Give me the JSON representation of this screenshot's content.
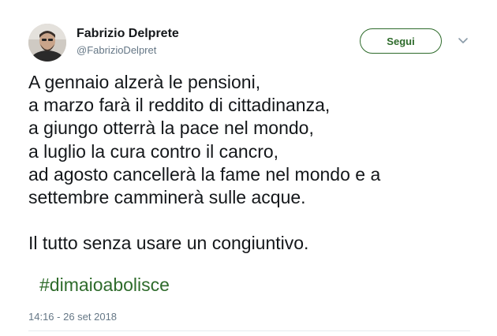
{
  "tweet": {
    "author": {
      "name": "Fabrizio Delprete",
      "handle": "@FabrizioDelpret",
      "avatar_icon": "user-avatar"
    },
    "follow_button_label": "Segui",
    "menu_icon": "chevron-down-icon",
    "text_lines": [
      "A gennaio alzerà le pensioni,",
      "a marzo farà il reddito di cittadinanza,",
      "a giungo otterrà la pace nel mondo,",
      "a luglio la cura contro il cancro,",
      "ad agosto cancellerà la fame nel mondo e a",
      "settembre camminerà sulle acque.",
      "",
      "Il tutto senza usare un congiuntivo."
    ],
    "hashtag": "#dimaioabolisce",
    "timestamp": "14:16 - 26 set 2018"
  },
  "colors": {
    "accent": "#2e6b2b",
    "secondary_text": "#657786",
    "primary_text": "#14171a"
  }
}
